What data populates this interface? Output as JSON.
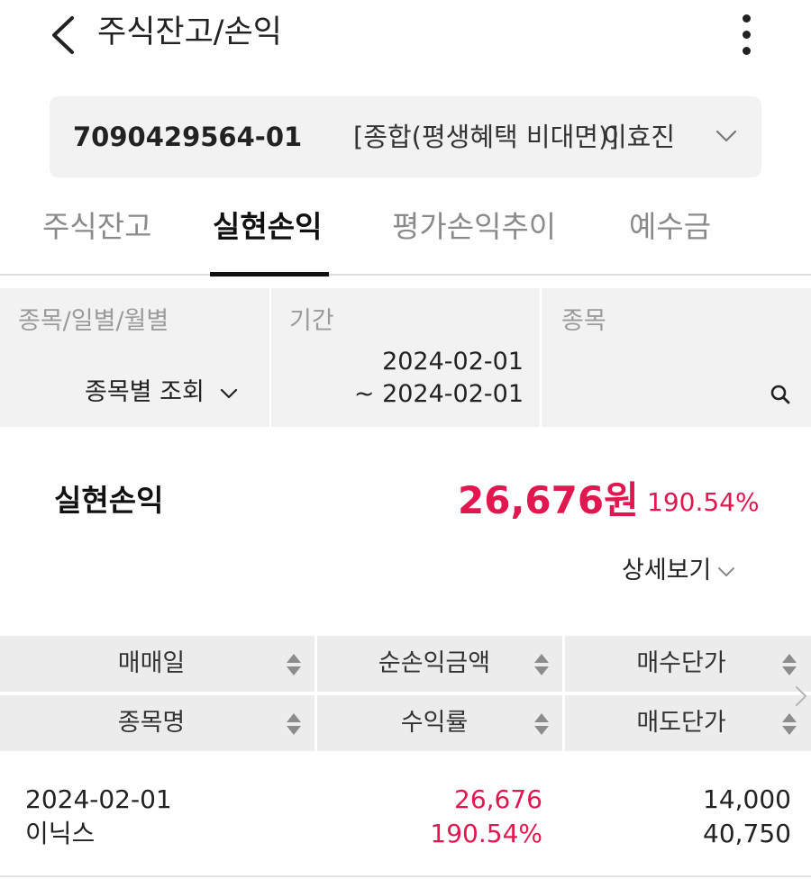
{
  "header": {
    "title": "주식잔고/손익"
  },
  "account": {
    "number": "7090429564-01",
    "type": "[종합(평생혜택 비대면)]",
    "owner": "이효진"
  },
  "tabs": [
    {
      "label": "주식잔고",
      "active": false
    },
    {
      "label": "실현손익",
      "active": true
    },
    {
      "label": "평가손익추이",
      "active": false
    },
    {
      "label": "예수금",
      "active": false
    }
  ],
  "filters": {
    "mode": {
      "label": "종목/일별/월별",
      "value": "종목별 조회"
    },
    "period": {
      "label": "기간",
      "from": "2024-02-01",
      "to": "~ 2024-02-01"
    },
    "stock": {
      "label": "종목",
      "value": ""
    }
  },
  "summary": {
    "label": "실현손익",
    "amount": "26,676원",
    "rate": "190.54%",
    "detail_label": "상세보기"
  },
  "table": {
    "headers_row1": [
      "매매일",
      "순손익금액",
      "매수단가"
    ],
    "headers_row2": [
      "종목명",
      "수익률",
      "매도단가"
    ],
    "rows": [
      {
        "date": "2024-02-01",
        "name": "이닉스",
        "profit": "26,676",
        "rate": "190.54%",
        "buy_price": "14,000",
        "sell_price": "40,750"
      }
    ]
  },
  "colors": {
    "accent": "#e0184f",
    "background": "#ffffff",
    "panel": "#f2f2f2"
  }
}
